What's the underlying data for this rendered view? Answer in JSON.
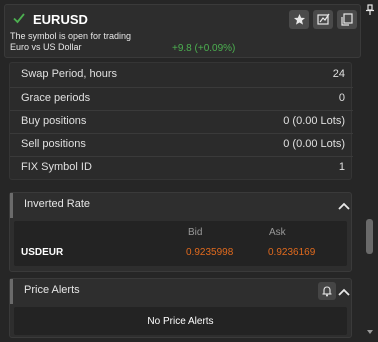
{
  "header": {
    "symbol": "EURUSD",
    "status": "The symbol is open for trading",
    "description": "Euro vs US Dollar",
    "change": "+9.8 (+0.09%)"
  },
  "properties": [
    {
      "label": "Swap Period, hours",
      "value": "24"
    },
    {
      "label": "Grace periods",
      "value": "0"
    },
    {
      "label": "Buy positions",
      "value": "0 (0.00 Lots)"
    },
    {
      "label": "Sell positions",
      "value": "0 (0.00 Lots)"
    },
    {
      "label": "FIX Symbol ID",
      "value": "1"
    }
  ],
  "inverted_rate": {
    "title": "Inverted Rate",
    "bid_label": "Bid",
    "ask_label": "Ask",
    "pair": "USDEUR",
    "bid": "0.9235998",
    "ask": "0.9236169"
  },
  "price_alerts": {
    "title": "Price Alerts",
    "empty_text": "No Price Alerts"
  },
  "colors": {
    "positive": "#4caf50",
    "rate": "#e06a1e",
    "background": "#262626"
  },
  "icons": [
    "check-icon",
    "star-icon",
    "edit-chart-icon",
    "detach-icon",
    "pin-icon",
    "chevron-up-icon",
    "bell-icon"
  ]
}
